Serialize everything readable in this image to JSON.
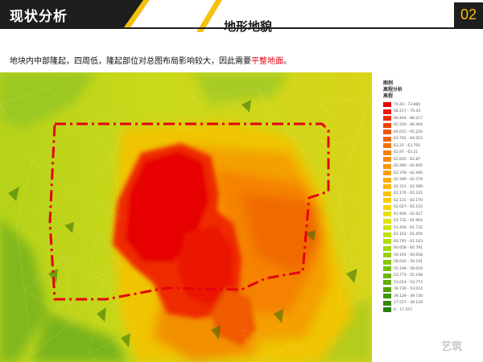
{
  "header": {
    "section_title": "现状分析",
    "subtitle": "地形地貌",
    "page_number": "02"
  },
  "description": {
    "text": "地块内中部隆起，四周低，隆起部位对总图布局影响较大，因此需要",
    "highlight": "平整地面",
    "end": "。"
  },
  "legend": {
    "title": "图例",
    "subtitle": "高程分析",
    "field": "高程",
    "items": [
      {
        "label": "70.43 - 73.880",
        "color": "#e60000"
      },
      {
        "label": "68.217 - 70.43",
        "color": "#ea1a00"
      },
      {
        "label": "66.404 - 68.217",
        "color": "#ec2e00"
      },
      {
        "label": "65.220 - 66.404",
        "color": "#ee4200"
      },
      {
        "label": "64.015 - 65.220",
        "color": "#f05500"
      },
      {
        "label": "63.792 - 64.015",
        "color": "#f26400"
      },
      {
        "label": "63.21 - 63.792",
        "color": "#f47300"
      },
      {
        "label": "62.87 - 63.21",
        "color": "#f58000"
      },
      {
        "label": "62.605 - 62.87",
        "color": "#f68c00"
      },
      {
        "label": "62.490 - 62.605",
        "color": "#f79800"
      },
      {
        "label": "62.378 - 62.490",
        "color": "#f8a300"
      },
      {
        "label": "62.289 - 62.378",
        "color": "#f9ae00"
      },
      {
        "label": "62.221 - 62.289",
        "color": "#fab800"
      },
      {
        "label": "62.170 - 62.221",
        "color": "#fbc200"
      },
      {
        "label": "62.115 - 62.170",
        "color": "#f8cc00"
      },
      {
        "label": "62.027 - 62.115",
        "color": "#f2d600"
      },
      {
        "label": "61.904 - 62.027",
        "color": "#e9de00"
      },
      {
        "label": "61.732 - 61.904",
        "color": "#dde400"
      },
      {
        "label": "61.456 - 61.732",
        "color": "#cfe600"
      },
      {
        "label": "61.163 - 61.456",
        "color": "#c0e300"
      },
      {
        "label": "60.791 - 61.163",
        "color": "#b2de00"
      },
      {
        "label": "60.058 - 60.791",
        "color": "#a4d800"
      },
      {
        "label": "59.191 - 60.058",
        "color": "#96d100"
      },
      {
        "label": "58.016 - 59.191",
        "color": "#88c900"
      },
      {
        "label": "55.198 - 58.016",
        "color": "#7ac100"
      },
      {
        "label": "53.773 - 55.198",
        "color": "#6cb800"
      },
      {
        "label": "53.014 - 53.773",
        "color": "#5eae00"
      },
      {
        "label": "39.730 - 53.014",
        "color": "#50a300"
      },
      {
        "label": "39.129 - 39.730",
        "color": "#439800"
      },
      {
        "label": "17.557 - 39.129",
        "color": "#368c00"
      },
      {
        "label": "0 - 17.557",
        "color": "#2a8000"
      }
    ]
  },
  "watermark": "艺筑",
  "colors": {
    "header_dark": "#1e1e1e",
    "accent_gold": "#f4c20e",
    "highlight_red": "#e60012",
    "boundary_red": "#e60012"
  }
}
